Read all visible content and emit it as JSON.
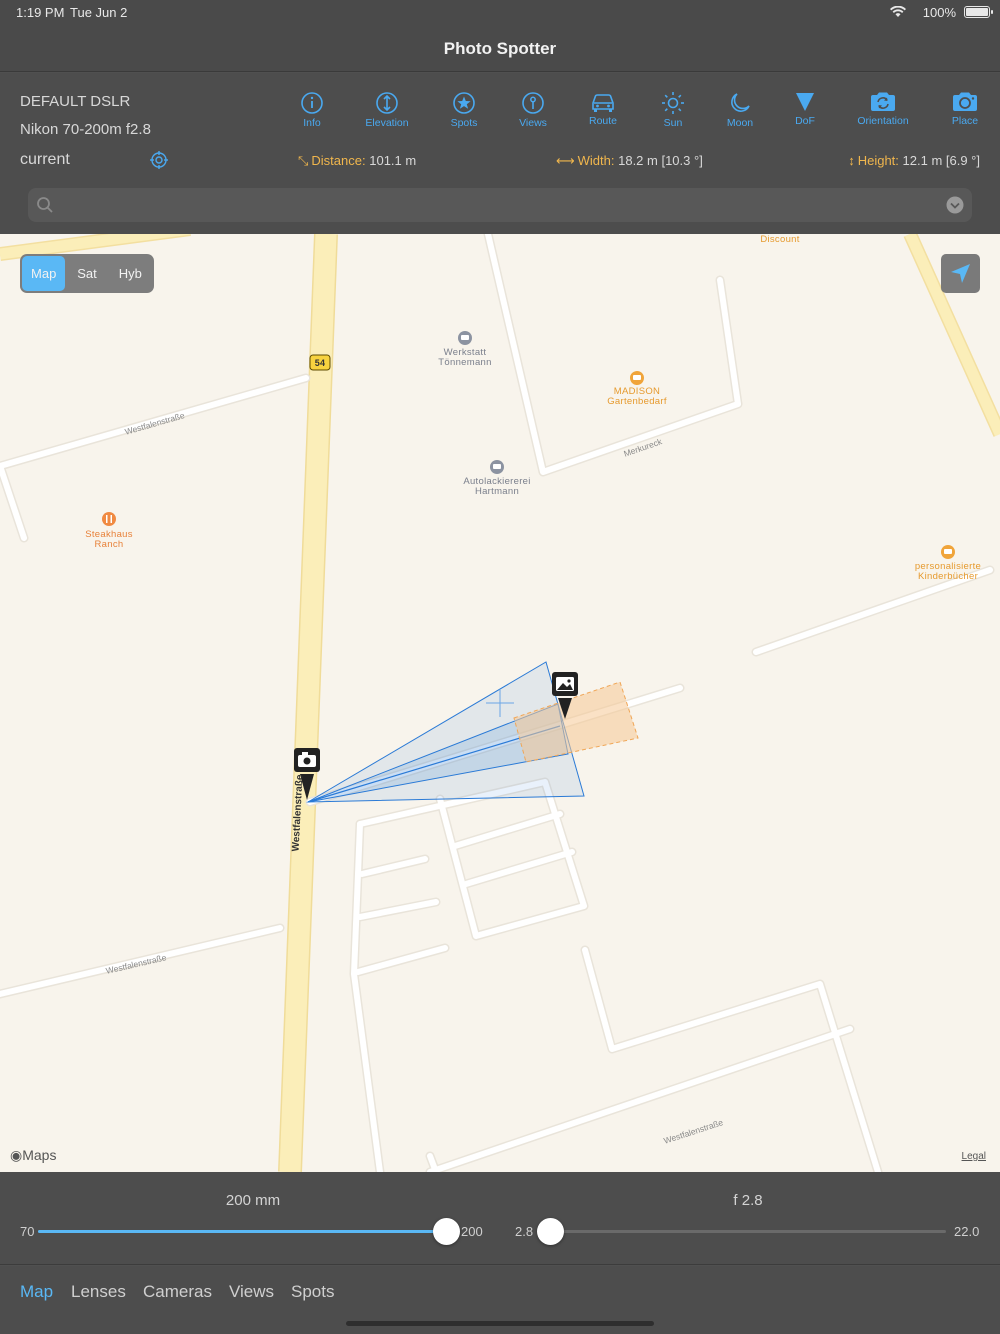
{
  "status": {
    "time": "1:19 PM",
    "date": "Tue Jun 2",
    "battery": "100%"
  },
  "nav": {
    "title": "Photo Spotter"
  },
  "gear": {
    "camera": "DEFAULT DSLR",
    "lens": "Nikon 70-200m f2.8",
    "location": "current"
  },
  "toolbar": [
    {
      "label": "Info",
      "icon": "info-icon"
    },
    {
      "label": "Elevation",
      "icon": "elevation-icon"
    },
    {
      "label": "Spots",
      "icon": "star-icon"
    },
    {
      "label": "Views",
      "icon": "views-icon"
    },
    {
      "label": "Route",
      "icon": "car-icon"
    },
    {
      "label": "Sun",
      "icon": "sun-icon"
    },
    {
      "label": "Moon",
      "icon": "moon-icon"
    },
    {
      "label": "DoF",
      "icon": "dof-icon"
    },
    {
      "label": "Orientation",
      "icon": "rotate-camera-icon"
    },
    {
      "label": "Place",
      "icon": "camera-icon"
    }
  ],
  "measurements": {
    "distance": {
      "label": "Distance:",
      "value": "101.1 m"
    },
    "width": {
      "label": "Width:",
      "value": "18.2 m [10.3 °]"
    },
    "height": {
      "label": "Height:",
      "value": "12.1 m [6.9 °]"
    }
  },
  "search": {
    "placeholder": "",
    "value": ""
  },
  "map": {
    "types": [
      "Map",
      "Sat",
      "Hyb"
    ],
    "active_type": "Map",
    "attribution": "Maps",
    "legal": "Legal",
    "road_shield": "54",
    "pois": [
      {
        "name": "Werkstatt\nTönnemann",
        "color": "#7a7f8c"
      },
      {
        "name": "MADISON\nGartenbedarf",
        "color": "#e69a2e"
      },
      {
        "name": "Autolackiererei\nHartmann",
        "color": "#7a7f8c"
      },
      {
        "name": "Steakhaus\nRanch",
        "color": "#e8823a"
      },
      {
        "name": "personalisierte\nKinderbücher",
        "color": "#e69a2e"
      },
      {
        "name": "Discount",
        "color": "#e69a2e"
      }
    ],
    "streets": [
      "Westfalenstraße",
      "Merkureck",
      "Westfalenstraße",
      "Westfalenstraße",
      "Westfalenstraße"
    ],
    "colors": {
      "land": "#f8f4ec",
      "major_road": "#fbeeb9",
      "road": "#ffffff",
      "fov": "#2a7ad6",
      "dof": "#f6c995"
    }
  },
  "sliders": {
    "focal": {
      "value_label": "200 mm",
      "min": "70",
      "max": "200",
      "min_value": 70,
      "max_value": 200,
      "current": 200
    },
    "aperture": {
      "value_label": "f 2.8",
      "min": "2.8",
      "max": "22.0",
      "min_value": 2.8,
      "max_value": 22.0,
      "current": 2.8
    }
  },
  "tabs": [
    "Map",
    "Lenses",
    "Cameras",
    "Views",
    "Spots"
  ],
  "active_tab": "Map"
}
